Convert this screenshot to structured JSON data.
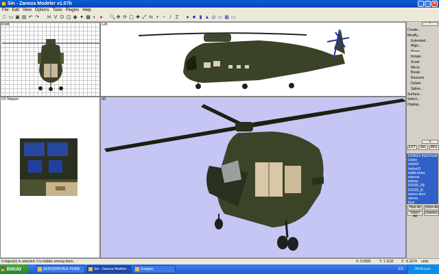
{
  "window": {
    "title": "Sin - Zanoza Modeler v1.07b"
  },
  "menu": [
    "File",
    "Edit",
    "View",
    "Options",
    "Tools",
    "Plugins",
    "Help"
  ],
  "toolbar_icons": [
    "new-icon",
    "open-icon",
    "save-icon",
    "print-icon",
    "undo-icon",
    "redo-icon",
    "h-icon",
    "v-icon",
    "d-icon",
    "cube-icon",
    "camera-icon",
    "light-icon",
    "texture-icon",
    "render-icon",
    "color-icon",
    "zoom-icon",
    "pan-icon",
    "rotate-icon",
    "select-icon",
    "move-icon",
    "scale-icon",
    "mirror-icon",
    "plus-icon",
    "minus-icon",
    "slash-icon",
    "z-icon",
    "sphere-icon",
    "box-icon",
    "cylinder-icon",
    "cone-icon",
    "torus-icon",
    "plane-icon",
    "grid-icon",
    "tube-icon"
  ],
  "viewports": {
    "front": "Front",
    "left": "Left",
    "uv": "UV Mapper",
    "three_d": "3D"
  },
  "right_panel": {
    "items": [
      {
        "label": "Create...",
        "level": "top"
      },
      {
        "label": "Modify...",
        "level": "top"
      },
      {
        "label": "Extended...",
        "level": "sub"
      },
      {
        "label": "Align...",
        "level": "sub"
      },
      {
        "label": "Move",
        "level": "sub"
      },
      {
        "label": "Rotate",
        "level": "sub"
      },
      {
        "label": "Scale",
        "level": "sub"
      },
      {
        "label": "Mirror",
        "level": "sub"
      },
      {
        "label": "Break",
        "level": "sub"
      },
      {
        "label": "Reorient",
        "level": "sub"
      },
      {
        "label": "Delete",
        "level": "sub"
      },
      {
        "label": "Spline...",
        "level": "sub"
      },
      {
        "label": "Surface...",
        "level": "top"
      },
      {
        "label": "Select...",
        "level": "top"
      },
      {
        "label": "Display...",
        "level": "top"
      }
    ],
    "mode_buttons": [
      "EXT",
      "SEL",
      "MUL"
    ],
    "objects": [
      "DORSO INSTRUM",
      "Union",
      "rotor01",
      "helice01",
      "rejilla toma",
      "marcos",
      "tobera",
      "DOOR_DE",
      "DOOR_IZ",
      "marco door",
      "eterno",
      "fuse"
    ],
    "hide_all": "Hide All",
    "show_all": "Show All",
    "select_all": "Select All",
    "deselect": "Deselect"
  },
  "status": {
    "message": "0 object(s) is selected. 0 is hidden among them.",
    "x": "X: 0.0000",
    "y": "Y: 1.1102",
    "z": "Z: -5.1574",
    "units": "units"
  },
  "taskbar": {
    "start": "Inicio",
    "tasks": [
      "AEROSPATIALE PUMA",
      "Sin - Zanoza Modeler ...",
      "Snapper"
    ],
    "lang": "ES",
    "clock": "04:41 p.m."
  },
  "colors": {
    "title_bar": "#0646b4",
    "viewport_3d_bg": "#c6c6f4",
    "helicopter_body": "#3c4428",
    "selection": "#3060c8",
    "taskbar": "#2257d0"
  }
}
